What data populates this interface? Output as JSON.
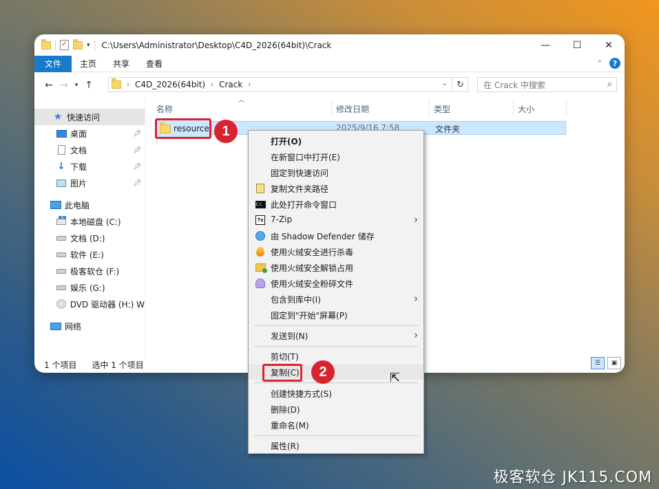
{
  "titlebar": {
    "path": "C:\\Users\\Administrator\\Desktop\\C4D_2026(64bit)\\Crack",
    "minimize": "—",
    "maximize": "☐",
    "close": "✕"
  },
  "ribbon": {
    "tabs": [
      "文件",
      "主页",
      "共享",
      "查看"
    ],
    "help": "?"
  },
  "address": {
    "crumbs": [
      "C4D_2026(64bit)",
      "Crack"
    ],
    "search_placeholder": "在 Crack 中搜索"
  },
  "sidebar": {
    "quick_access": "快速访问",
    "quick_items": [
      "桌面",
      "文档",
      "下载",
      "图片"
    ],
    "this_pc": "此电脑",
    "drives": [
      "本地磁盘 (C:)",
      "文档 (D:)",
      "软件 (E:)",
      "极客软仓 (F:)",
      "娱乐 (G:)",
      "DVD 驱动器 (H:) W"
    ],
    "network": "网络"
  },
  "columns": [
    "名称",
    "修改日期",
    "类型",
    "大小"
  ],
  "files": [
    {
      "name": "resource",
      "date": "2025/9/16 7:58",
      "type": "文件夹",
      "size": ""
    }
  ],
  "status": {
    "count": "1 个项目",
    "selected": "选中 1 个项目"
  },
  "badges": [
    "1",
    "2"
  ],
  "context_menu": {
    "items": [
      {
        "label": "打开(O)",
        "icon": "none"
      },
      {
        "label": "在新窗口中打开(E)",
        "icon": "none"
      },
      {
        "label": "固定到快速访问",
        "icon": "none"
      },
      {
        "label": "复制文件夹路径",
        "icon": "clipboard-icon"
      },
      {
        "label": "此处打开命令窗口",
        "icon": "cmd-icon"
      },
      {
        "label": "7-Zip",
        "icon": "7zip-icon"
      },
      {
        "label": "由 Shadow Defender 储存",
        "icon": "shadow-defender-icon"
      },
      {
        "label": "使用火绒安全进行杀毒",
        "icon": "huorong-icon"
      },
      {
        "label": "使用火绒安全解锁占用",
        "icon": "unlock-icon"
      },
      {
        "label": "使用火绒安全粉碎文件",
        "icon": "shred-icon"
      },
      {
        "label": "包含到库中(I)",
        "icon": "none"
      },
      {
        "label": "固定到\"开始\"屏幕(P)",
        "icon": "none"
      },
      {
        "label": "发送到(N)",
        "icon": "none"
      },
      {
        "label": "剪切(T)",
        "icon": "none"
      },
      {
        "label": "复制(C)",
        "icon": "none"
      },
      {
        "label": "创建快捷方式(S)",
        "icon": "none"
      },
      {
        "label": "删除(D)",
        "icon": "none"
      },
      {
        "label": "重命名(M)",
        "icon": "none"
      },
      {
        "label": "属性(R)",
        "icon": "none"
      }
    ],
    "submenu_arrow": "›"
  },
  "watermark": "极客软仓 JK115.COM",
  "colors": {
    "accent": "#1979ca",
    "highlight_red": "#d9232f",
    "selection": "#cce8ff"
  }
}
